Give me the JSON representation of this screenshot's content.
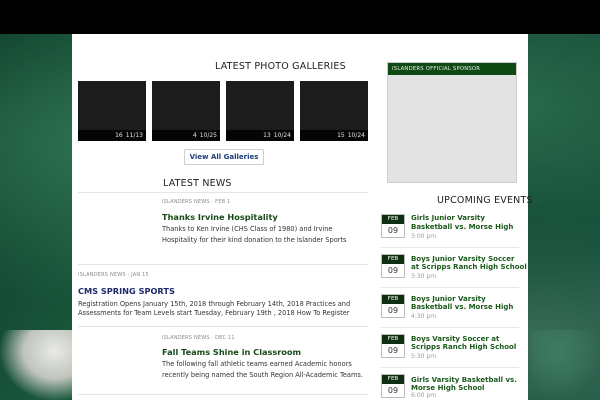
{
  "galleries": {
    "title": "LATEST PHOTO GALLERIES",
    "items": [
      {
        "count": "16",
        "date": "11/13"
      },
      {
        "count": "4",
        "date": "10/25"
      },
      {
        "count": "13",
        "date": "10/24"
      },
      {
        "count": "15",
        "date": "10/24"
      }
    ],
    "view_all": "View All Galleries"
  },
  "news": {
    "title": "LATEST NEWS",
    "items": [
      {
        "meta": "ISLANDERS NEWS · FEB 1",
        "headline": "Thanks Irvine Hospitality",
        "excerpt": [
          "Thanks to Ken Irvine (CHS Class of 1980) and Irvine",
          "Hospitality for their kind donation to the Islander Sports"
        ]
      },
      {
        "meta": "ISLANDERS NEWS · JAN 15",
        "headline": "CMS SPRING SPORTS",
        "excerpt": [
          "Registration Opens January 15th, 2018 through February 14th, 2018   Practices and",
          "Assessments for Team Levels start Tuesday, February 19th , 2018   How To Register"
        ]
      },
      {
        "meta": "ISLANDERS NEWS · DEC 11",
        "headline": "Fall Teams Shine in Classroom",
        "excerpt": [
          "  The following fall athletic teams earned Academic honors",
          "recently being named the South Region All-Academic Teams."
        ]
      }
    ]
  },
  "sponsor": {
    "label": "ISLANDERS OFFICIAL SPONSOR"
  },
  "events": {
    "title": "UPCOMING EVENTS",
    "items": [
      {
        "month": "FEB",
        "day": "09",
        "title": [
          "Girls Junior Varsity",
          "Basketball vs. Morse High"
        ],
        "time": "3:00 pm"
      },
      {
        "month": "FEB",
        "day": "09",
        "title": [
          "Boys Junior Varsity Soccer",
          "at Scripps Ranch High School"
        ],
        "time": "3:30 pm"
      },
      {
        "month": "FEB",
        "day": "09",
        "title": [
          "Boys Junior Varsity",
          "Basketball vs. Morse High"
        ],
        "time": "4:30 pm"
      },
      {
        "month": "FEB",
        "day": "09",
        "title": [
          "Boys Varsity Soccer at",
          "Scripps Ranch High School"
        ],
        "time": "5:30 pm"
      },
      {
        "month": "FEB",
        "day": "09",
        "title": [
          "Girls Varsity Basketball vs.",
          "Morse High School"
        ],
        "time": "6:00 pm"
      }
    ]
  }
}
